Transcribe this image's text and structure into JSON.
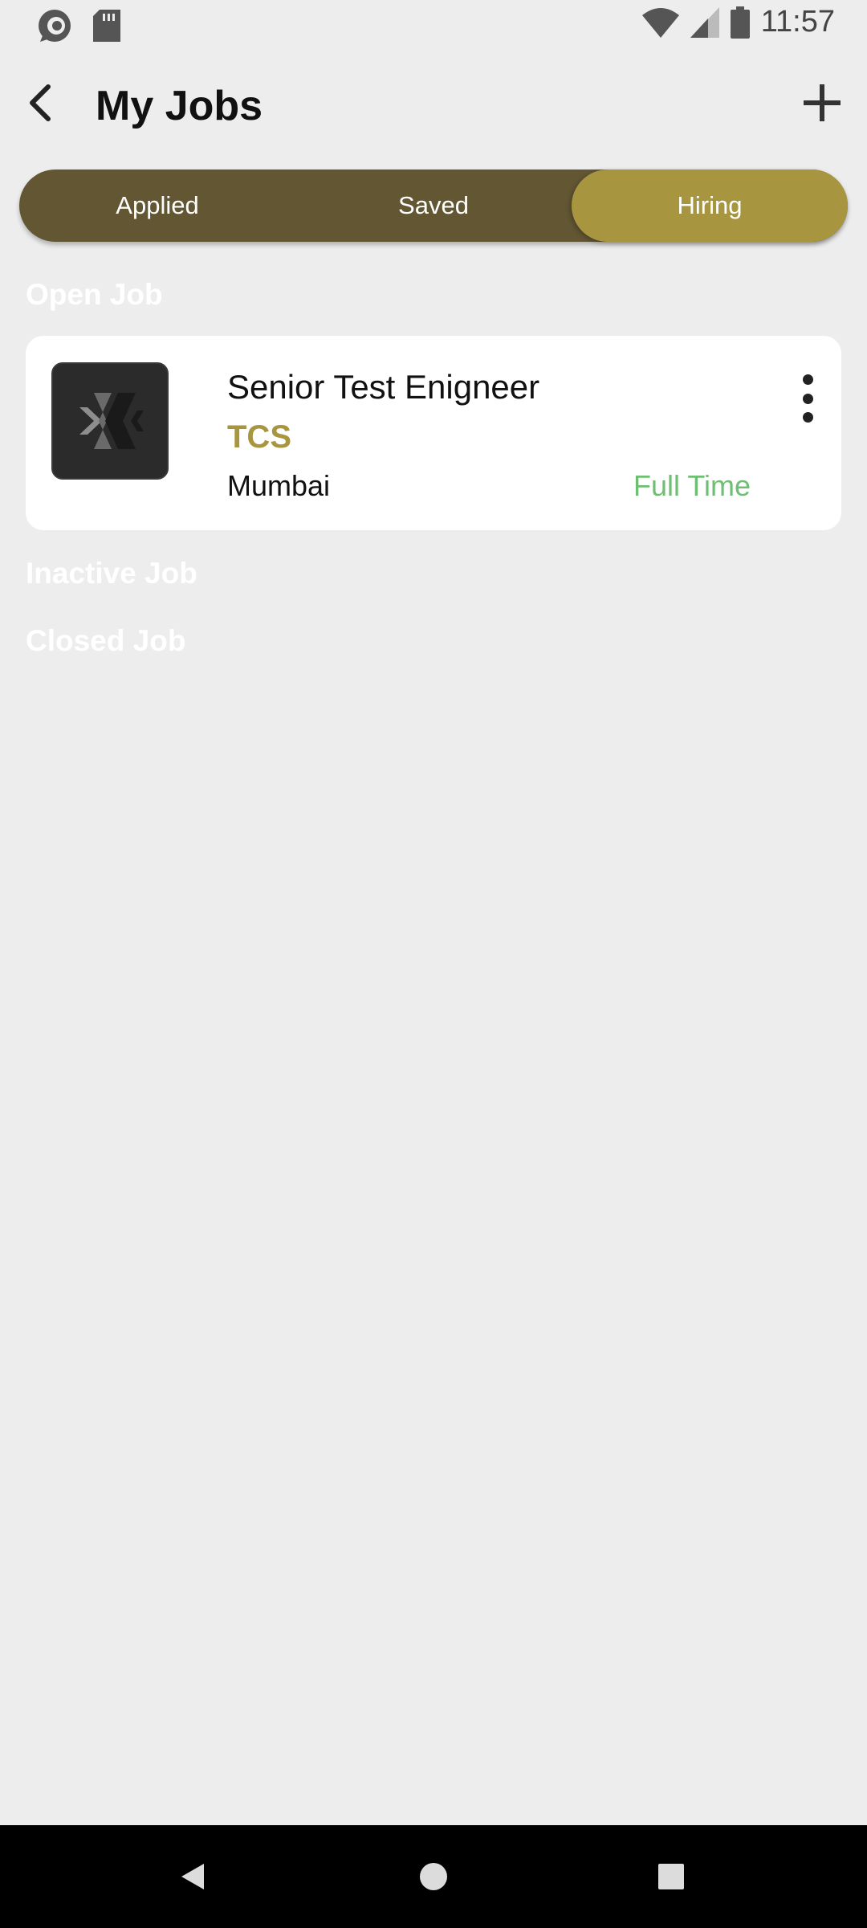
{
  "status_bar": {
    "time": "11:57",
    "left_icons": [
      "sync-icon",
      "sd-card-icon"
    ],
    "right_icons": [
      "wifi-icon",
      "cell-signal-icon",
      "battery-icon"
    ]
  },
  "header": {
    "title": "My Jobs",
    "back_icon": "back-arrow-icon",
    "add_icon": "plus-icon"
  },
  "tabs": [
    {
      "label": "Applied",
      "active": false
    },
    {
      "label": "Saved",
      "active": false
    },
    {
      "label": "Hiring",
      "active": true
    }
  ],
  "sections": {
    "open": "Open Job",
    "inactive": "Inactive Job",
    "closed": "Closed Job"
  },
  "jobs": [
    {
      "title": "Senior Test Enigneer",
      "company": "TCS",
      "location": "Mumbai",
      "type": "Full Time",
      "logo_icon": "company-logo-icon",
      "menu_icon": "more-vertical-icon"
    }
  ],
  "nav": {
    "back": "nav-back-icon",
    "home": "nav-home-icon",
    "recents": "nav-recents-icon"
  },
  "colors": {
    "background": "#ededed",
    "tab_bar": "#625633",
    "tab_active": "#a89540",
    "company": "#a89540",
    "job_type": "#6fbf73"
  }
}
